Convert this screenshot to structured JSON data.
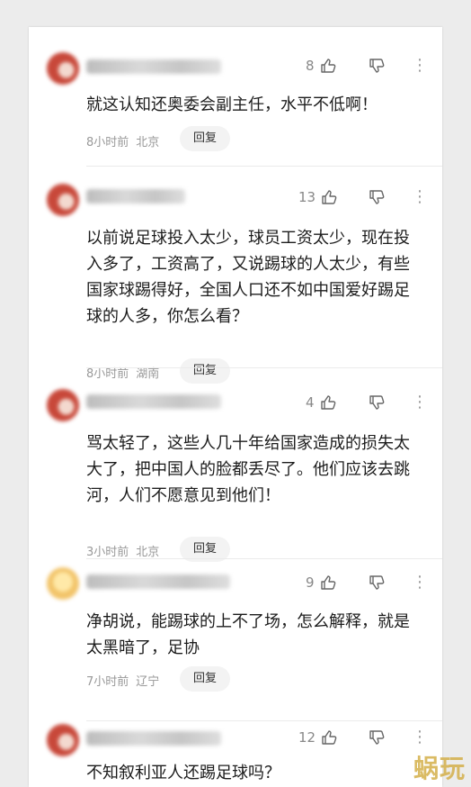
{
  "comments": [
    {
      "avatar": "red-avatar",
      "likes": "8",
      "content": "就这认知还奥委会副主任，水平不低啊！",
      "time": "8小时前",
      "location": "北京",
      "reply": "回复"
    },
    {
      "avatar": "red-avatar",
      "likes": "13",
      "content": "以前说足球投入太少，球员工资太少，现在投入多了，工资高了，又说踢球的人太少，有些国家球踢得好，全国人口还不如中国爱好踢足球的人多，你怎么看？",
      "time": "8小时前",
      "location": "湖南",
      "reply": "回复"
    },
    {
      "avatar": "red-avatar",
      "likes": "4",
      "content": "骂太轻了，这些人几十年给国家造成的损失太大了，把中国人的脸都丢尽了。他们应该去跳河，人们不愿意见到他们！",
      "time": "3小时前",
      "location": "北京",
      "reply": "回复"
    },
    {
      "avatar": "yellow-avatar",
      "likes": "9",
      "content": "净胡说，能踢球的上不了场，怎么解释，就是太黑暗了，足协",
      "time": "7小时前",
      "location": "辽宁",
      "reply": "回复"
    },
    {
      "avatar": "red-avatar",
      "likes": "12",
      "content": "不知叙利亚人还踢足球吗？",
      "time": "",
      "location": "",
      "reply": ""
    }
  ],
  "icons": {
    "like": "thumbs-up-icon",
    "dislike": "thumbs-down-icon",
    "more": "more-vertical-icon"
  },
  "colors": {
    "background": "#ececec",
    "card": "#ffffff",
    "text": "#1c1c1c",
    "meta": "#999999",
    "reply_bg": "#f3f3f3"
  },
  "watermark": "蜗玩"
}
